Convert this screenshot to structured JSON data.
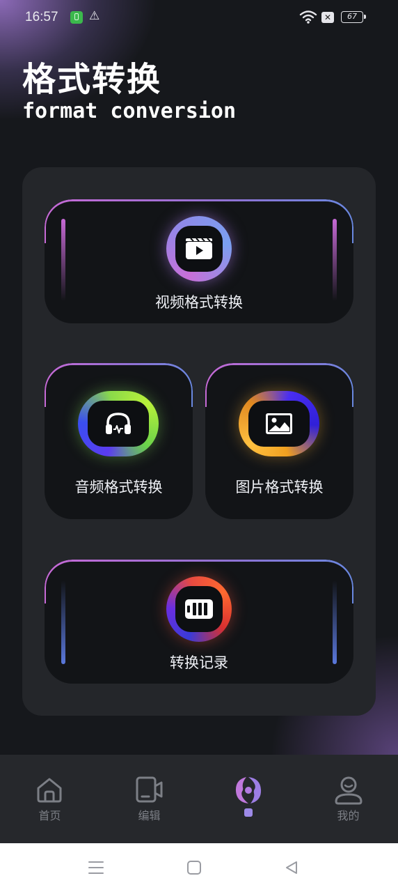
{
  "status": {
    "time": "16:57",
    "battery": "67"
  },
  "header": {
    "title": "格式转换",
    "subtitle": "format conversion"
  },
  "cards": {
    "video": "视频格式转换",
    "audio": "音频格式转换",
    "image": "图片格式转换",
    "history": "转换记录"
  },
  "nav": {
    "home": "首页",
    "edit": "编辑",
    "mine": "我的"
  },
  "colors": {
    "background": "#16181c",
    "panel": "#24262a",
    "card": "#121417",
    "accent_purple": "#c76ad6",
    "accent_blue": "#6a88e0",
    "nav_active": "#8f72d4"
  }
}
